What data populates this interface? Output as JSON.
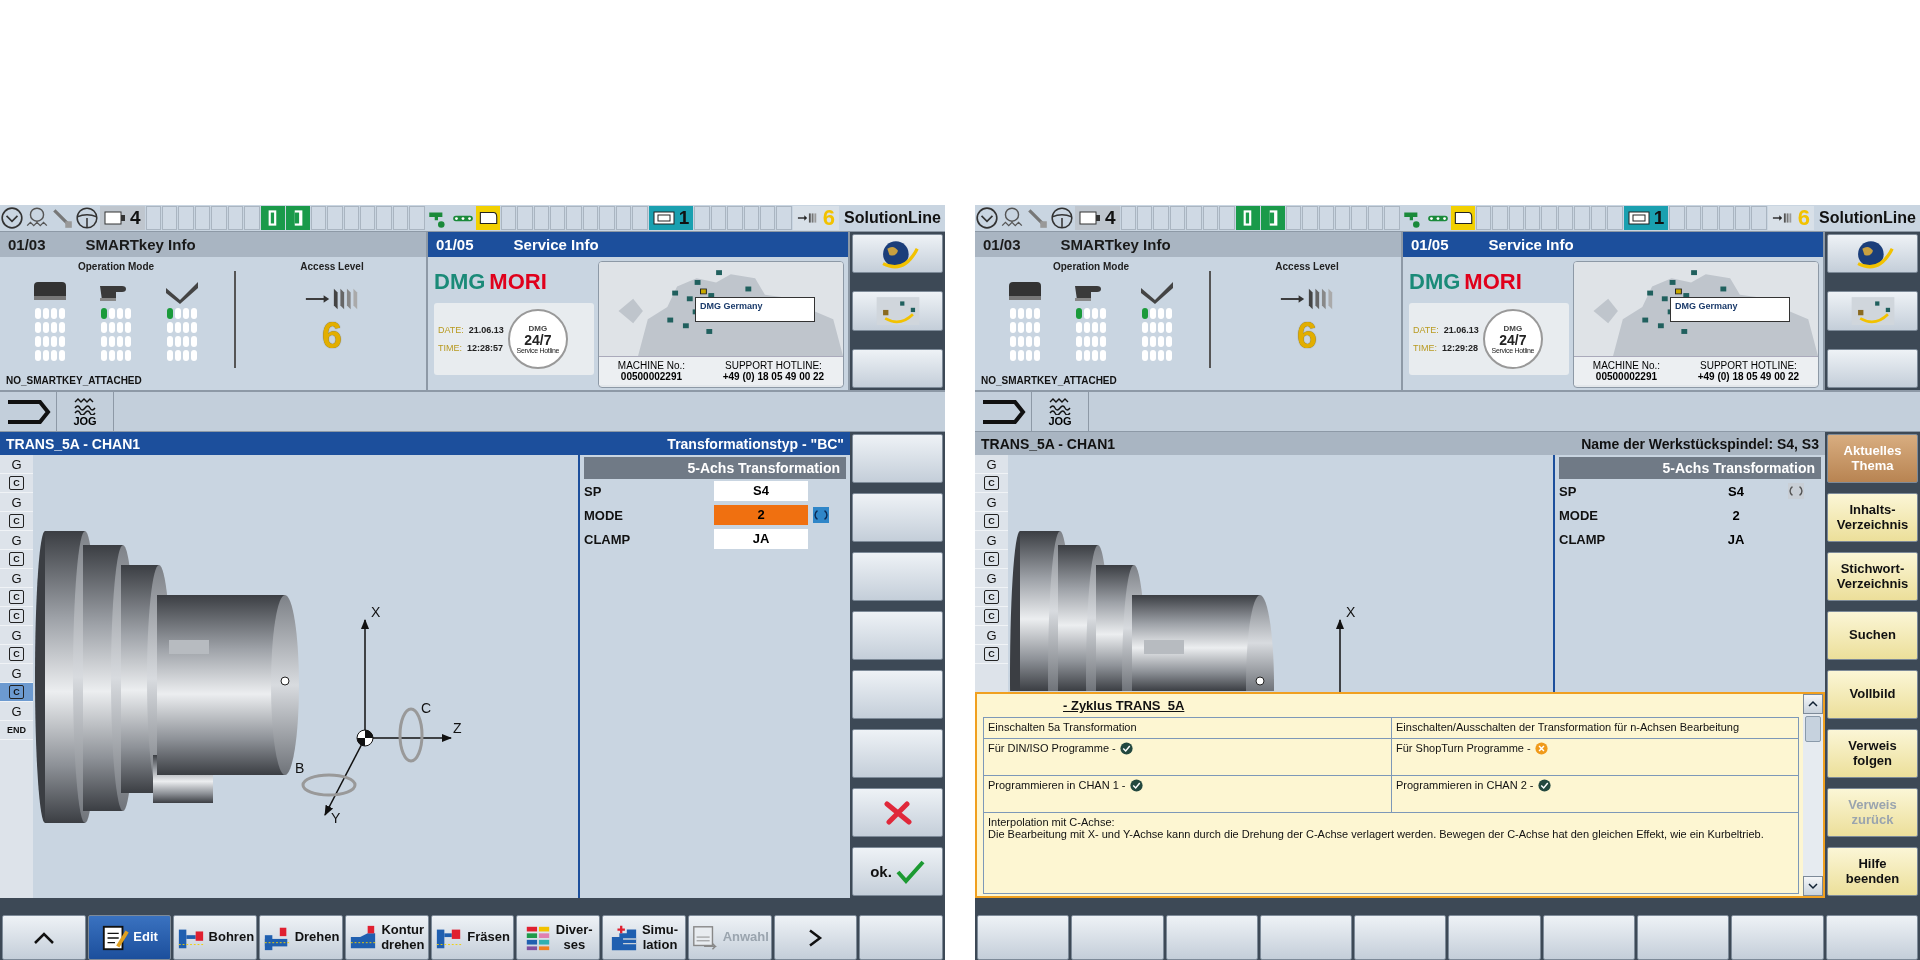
{
  "screens": [
    {
      "status_bar": {
        "channel_count": "4",
        "channel": "1",
        "access_level": "6",
        "product": "SolutionLine"
      },
      "smartkey_panel": {
        "number": "01/03",
        "title": "SMARTkey Info",
        "active": false,
        "operation_mode_label": "Operation Mode",
        "modes": [
          {
            "kind": "key",
            "lit": false
          },
          {
            "kind": "hand",
            "lit": true
          },
          {
            "kind": "check",
            "lit": true
          }
        ],
        "access_level_label": "Access Level",
        "access_level": "6",
        "key_status": "NO_SMARTKEY_ATTACHED"
      },
      "service_panel": {
        "number": "01/05",
        "title": "Service Info",
        "active": true,
        "logo_first": "DMG",
        "logo_second": "MORI",
        "date_label": "DATE:",
        "date": "21.06.13",
        "time_label": "TIME:",
        "time": "12:28:57",
        "badge_brand": "DMG",
        "badge": "24/7",
        "badge_caption": "Service Hotline",
        "map_callout": "DMG Germany",
        "machine_label": "MACHINE No.:",
        "machine_number": "00500002291",
        "hotline_label": "SUPPORT HOTLINE:",
        "hotline": "+49 (0) 18 05 49 00 22"
      },
      "side_keys_top": [
        {
          "kind": "globe"
        },
        {
          "kind": "map"
        },
        {
          "kind": "blank"
        }
      ],
      "mode": "JOG",
      "editor": {
        "title": "TRANS_5A - CHAN1",
        "info": "Transformationstyp - \"BC\"",
        "active": true
      },
      "program_lines": [
        {
          "kind": "g",
          "text": "G",
          "selected": false
        },
        {
          "kind": "cycle",
          "text": "C",
          "selected": false
        },
        {
          "kind": "g",
          "text": "G",
          "selected": false
        },
        {
          "kind": "cycle",
          "text": "C",
          "selected": false
        },
        {
          "kind": "g",
          "text": "G",
          "selected": false
        },
        {
          "kind": "cycle",
          "text": "C",
          "selected": false
        },
        {
          "kind": "g",
          "text": "G",
          "selected": false
        },
        {
          "kind": "cycle",
          "text": "C",
          "selected": false
        },
        {
          "kind": "cycle",
          "text": "C",
          "selected": false
        },
        {
          "kind": "g",
          "text": "G",
          "selected": false
        },
        {
          "kind": "cycle",
          "text": "C",
          "selected": false
        },
        {
          "kind": "g",
          "text": "G",
          "selected": false
        },
        {
          "kind": "cycle",
          "text": "C",
          "selected": true
        },
        {
          "kind": "g",
          "text": "G",
          "selected": false
        },
        {
          "kind": "end",
          "text": "END",
          "selected": false
        }
      ],
      "axes": [
        {
          "kind": "x",
          "label": "X"
        },
        {
          "kind": "c",
          "label": "C"
        },
        {
          "kind": "z",
          "label": "Z"
        },
        {
          "kind": "b",
          "label": "B"
        },
        {
          "kind": "y",
          "label": "Y"
        }
      ],
      "parameters": {
        "kind": "edit",
        "header": "5-Achs Transformation",
        "rows": [
          {
            "label": "SP",
            "value": "S4",
            "selected": false
          },
          {
            "label": "MODE",
            "value": "2",
            "selected": true
          },
          {
            "label": "CLAMP",
            "value": "JA",
            "selected": false
          }
        ]
      },
      "side_keys": [
        {
          "kind": "blank"
        },
        {
          "kind": "blank"
        },
        {
          "kind": "blank"
        },
        {
          "kind": "blank"
        },
        {
          "kind": "blank"
        },
        {
          "kind": "blank"
        },
        {
          "kind": "cancel"
        },
        {
          "kind": "ok",
          "label": "ok."
        }
      ],
      "bottom_keys": [
        {
          "kind": "back",
          "selected": false,
          "disabled": false
        },
        {
          "kind": "edit",
          "label": "Edit",
          "selected": true,
          "disabled": false
        },
        {
          "kind": "drill",
          "label": "Bohren",
          "selected": false,
          "disabled": false
        },
        {
          "kind": "turn",
          "label": "Drehen",
          "selected": false,
          "disabled": false
        },
        {
          "kind": "contour",
          "label": "Kontur\ndrehen",
          "selected": false,
          "disabled": false
        },
        {
          "kind": "mill",
          "label": "Fräsen",
          "selected": false,
          "disabled": false
        },
        {
          "kind": "misc",
          "label": "Diver-\nses",
          "selected": false,
          "disabled": false
        },
        {
          "kind": "simulation",
          "label": "Simu-\nlation",
          "selected": false,
          "disabled": false
        },
        {
          "kind": "select",
          "label": "Anwahl",
          "selected": false,
          "disabled": true
        },
        {
          "kind": "next",
          "selected": false,
          "disabled": false
        },
        {
          "kind": "blank"
        }
      ]
    },
    {
      "status_bar": {
        "channel_count": "4",
        "channel": "1",
        "access_level": "6",
        "product": "SolutionLine"
      },
      "smartkey_panel": {
        "number": "01/03",
        "title": "SMARTkey Info",
        "active": false,
        "operation_mode_label": "Operation Mode",
        "modes": [
          {
            "kind": "key",
            "lit": false
          },
          {
            "kind": "hand",
            "lit": true
          },
          {
            "kind": "check",
            "lit": true
          }
        ],
        "access_level_label": "Access Level",
        "access_level": "6",
        "key_status": "NO_SMARTKEY_ATTACHED"
      },
      "service_panel": {
        "number": "01/05",
        "title": "Service Info",
        "active": true,
        "logo_first": "DMG",
        "logo_second": "MORI",
        "date_label": "DATE:",
        "date": "21.06.13",
        "time_label": "TIME:",
        "time": "12:29:28",
        "badge_brand": "DMG",
        "badge": "24/7",
        "badge_caption": "Service Hotline",
        "map_callout": "DMG Germany",
        "machine_label": "MACHINE No.:",
        "machine_number": "00500002291",
        "hotline_label": "SUPPORT HOTLINE:",
        "hotline": "+49 (0) 18 05 49 00 22"
      },
      "side_keys_top": [
        {
          "kind": "globe"
        },
        {
          "kind": "map"
        },
        {
          "kind": "blank"
        }
      ],
      "mode": "JOG",
      "editor": {
        "title": "TRANS_5A - CHAN1",
        "info": "Name der Werkstückspindel: S4, S3",
        "active": false
      },
      "program_lines": [
        {
          "kind": "g",
          "text": "G",
          "selected": false
        },
        {
          "kind": "cycle",
          "text": "C",
          "selected": false
        },
        {
          "kind": "g",
          "text": "G",
          "selected": false
        },
        {
          "kind": "cycle",
          "text": "C",
          "selected": false
        },
        {
          "kind": "g",
          "text": "G",
          "selected": false
        },
        {
          "kind": "cycle",
          "text": "C",
          "selected": false
        },
        {
          "kind": "g",
          "text": "G",
          "selected": false
        },
        {
          "kind": "cycle",
          "text": "C",
          "selected": false
        },
        {
          "kind": "cycle",
          "text": "C",
          "selected": false
        },
        {
          "kind": "g",
          "text": "G",
          "selected": false
        },
        {
          "kind": "cycle",
          "text": "C",
          "selected": false
        }
      ],
      "axes": [
        {
          "kind": "x",
          "label": "X"
        }
      ],
      "parameters": {
        "kind": "view",
        "header": "5-Achs Transformation",
        "rows": [
          {
            "label": "SP",
            "value": "S4",
            "selected": true
          },
          {
            "label": "MODE",
            "value": "2",
            "selected": false
          },
          {
            "label": "CLAMP",
            "value": "JA",
            "selected": false
          }
        ]
      },
      "help": {
        "title": "- Zyklus TRANS_5A",
        "rows": [
          [
            {
              "text": "Einschalten 5a Transformation"
            },
            {
              "text": "Einschalten/Ausschalten der Transformation für n-Achsen Bearbeitung"
            }
          ],
          [
            {
              "text": "Für DIN/ISO Programme -",
              "available": true
            },
            {
              "text": "Für ShopTurn Programme -",
              "available": false
            }
          ],
          [
            {
              "text": "Programmieren in CHAN 1 -",
              "available": true
            },
            {
              "text": "Programmieren in CHAN 2 -",
              "available": true
            }
          ]
        ],
        "note_heading": "Interpolation mit C-Achse:",
        "note": "Die Bearbeitung mit X- und Y-Achse kann durch die Drehung der C-Achse verlagert werden. Bewegen der C-Achse hat den gleichen Effekt, wie ein Kurbeltrieb."
      },
      "side_keys": [
        {
          "kind": "help",
          "label": "Aktuelles\nThema",
          "selected": true,
          "disabled": false
        },
        {
          "kind": "help",
          "label": "Inhalts-\nVerzeichnis",
          "selected": false,
          "disabled": false
        },
        {
          "kind": "help",
          "label": "Stichwort-\nVerzeichnis",
          "selected": false,
          "disabled": false
        },
        {
          "kind": "help",
          "label": "Suchen",
          "selected": false,
          "disabled": false
        },
        {
          "kind": "help",
          "label": "Vollbild",
          "selected": false,
          "disabled": false
        },
        {
          "kind": "help",
          "label": "Verweis\nfolgen",
          "selected": false,
          "disabled": false
        },
        {
          "kind": "help",
          "label": "Verweis\nzurück",
          "selected": false,
          "disabled": true
        },
        {
          "kind": "help",
          "label": "Hilfe\nbeenden",
          "selected": false,
          "disabled": false
        }
      ],
      "bottom_keys": [
        {
          "kind": "blank"
        },
        {
          "kind": "blank"
        },
        {
          "kind": "blank"
        },
        {
          "kind": "blank"
        },
        {
          "kind": "blank"
        },
        {
          "kind": "blank"
        },
        {
          "kind": "blank"
        },
        {
          "kind": "blank"
        },
        {
          "kind": "blank"
        },
        {
          "kind": "blank"
        }
      ]
    }
  ]
}
